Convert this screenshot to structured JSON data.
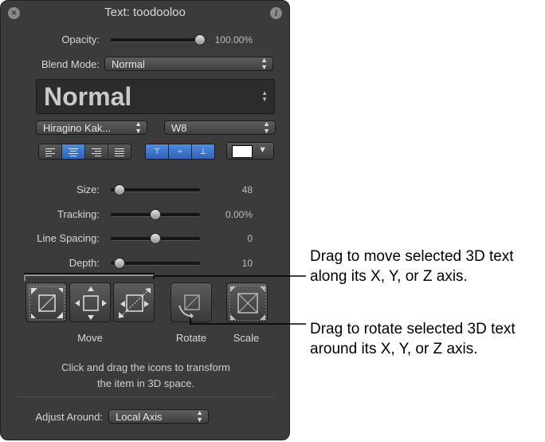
{
  "window": {
    "title": "Text: toodooloo",
    "close_icon": "close-icon",
    "info_icon": "info-icon"
  },
  "opacity": {
    "label": "Opacity:",
    "value": "100.00%",
    "level": 1.0
  },
  "blend_mode": {
    "label": "Blend Mode:",
    "selected": "Normal"
  },
  "style_preset": {
    "selected": "Normal"
  },
  "font": {
    "family": "Hiragino Kak...",
    "weight": "W8"
  },
  "alignment": {
    "horizontal_selected": 1,
    "vertical_selected": [
      0,
      1,
      2
    ]
  },
  "color": {
    "swatch": "#ffffff"
  },
  "sliders": [
    {
      "key": "size",
      "label": "Size:",
      "value": "48",
      "level": 0.1
    },
    {
      "key": "tracking",
      "label": "Tracking:",
      "value": "0.00%",
      "level": 0.5
    },
    {
      "key": "line_spacing",
      "label": "Line Spacing:",
      "value": "0",
      "level": 0.5
    },
    {
      "key": "depth",
      "label": "Depth:",
      "value": "10",
      "level": 0.1
    }
  ],
  "transform": {
    "move_label": "Move",
    "rotate_label": "Rotate",
    "scale_label": "Scale",
    "hint_line1": "Click and drag the icons to transform",
    "hint_line2": "the item in 3D space."
  },
  "adjust_around": {
    "label": "Adjust Around:",
    "selected": "Local Axis"
  },
  "callouts": {
    "move_line1": "Drag to move selected 3D text",
    "move_line2": "along its X, Y, or Z axis.",
    "rotate_line1": "Drag to rotate selected 3D text",
    "rotate_line2": "around its X, Y, or Z axis."
  },
  "colors": {
    "hud_bg": "#3b3b3c",
    "accent_blue": "#3f7ad0",
    "text": "#d6d6d6"
  }
}
